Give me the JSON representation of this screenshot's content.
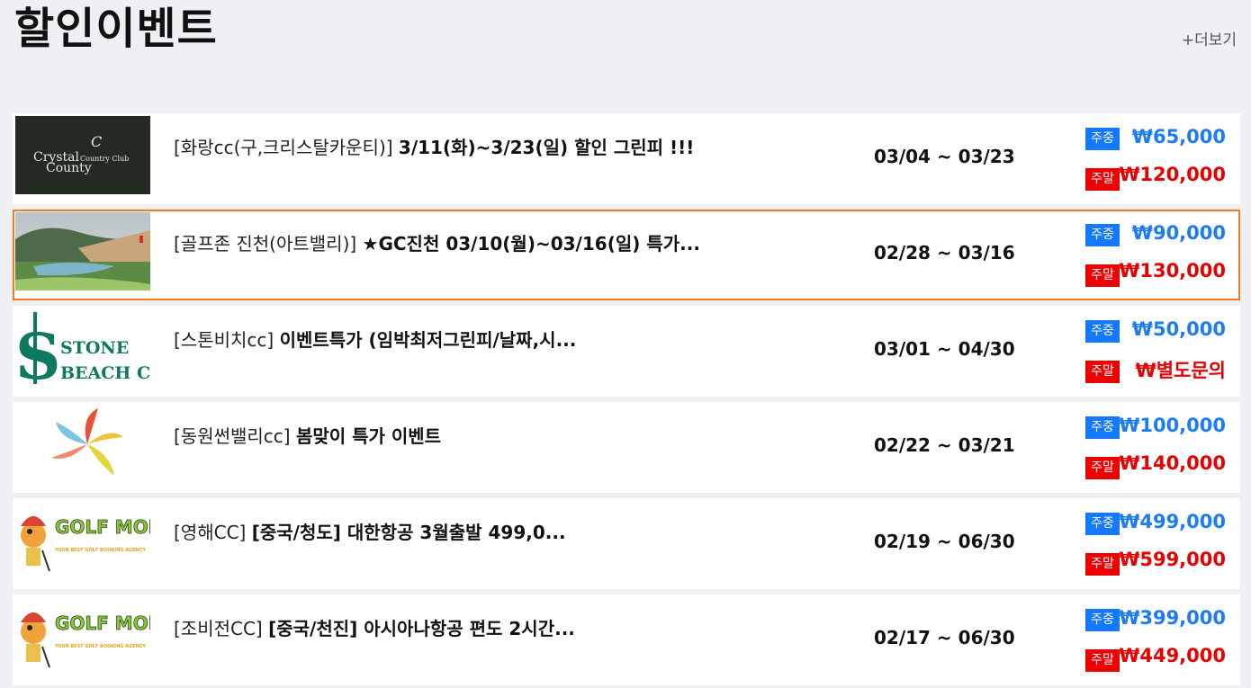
{
  "header": {
    "title": "할인이벤트",
    "more_label": "+더보기"
  },
  "badges": {
    "weekday": "주중",
    "weekend": "주말"
  },
  "events": [
    {
      "logo": "crystal-county-logo",
      "logo_text": [
        "Crystal",
        "County",
        "Country Club"
      ],
      "club": "[화랑cc(구,크리스탈카운티)]",
      "title": "3/11(화)~3/23(일) 할인 그린피 !!!",
      "period": "03/04 ~ 03/23",
      "weekday_price": "₩65,000",
      "weekend_price": "₩120,000"
    },
    {
      "logo": "golf-course-photo",
      "club": "[골프존 진천(아트밸리)]",
      "title": "★GC진천 03/10(월)~03/16(일) 특가...",
      "period": "02/28 ~ 03/16",
      "weekday_price": "₩90,000",
      "weekend_price": "₩130,000"
    },
    {
      "logo": "stone-beach-logo",
      "logo_text": [
        "STONE",
        "BEACH CC"
      ],
      "club": "[스톤비치cc]",
      "title": "이벤트특가 (임박최저그린피/날짜,시...",
      "period": "03/01 ~ 04/30",
      "weekday_price": "₩50,000",
      "weekend_price": "₩별도문의"
    },
    {
      "logo": "dongwon-sunvalley-logo",
      "club": "[동원썬밸리cc]",
      "title": "봄맞이 특가 이벤트",
      "period": "02/22 ~ 03/21",
      "weekday_price": "₩100,000",
      "weekend_price": "₩140,000"
    },
    {
      "logo": "golfmon-logo",
      "logo_text": [
        "GOLF MON",
        "YOUR BEST GOLF BOOKING AGENCY"
      ],
      "club": "[영해CC]",
      "title": "[중국/청도] 대한항공 3월출발 499,0...",
      "period": "02/19 ~ 06/30",
      "weekday_price": "₩499,000",
      "weekend_price": "₩599,000"
    },
    {
      "logo": "golfmon-logo",
      "logo_text": [
        "GOLF MON",
        "YOUR BEST GOLF BOOKING AGENCY"
      ],
      "club": "[조비전CC]",
      "title": "[중국/천진] 아시아나항공 편도 2시간...",
      "period": "02/17 ~ 06/30",
      "weekday_price": "₩399,000",
      "weekend_price": "₩449,000"
    }
  ],
  "colors": {
    "weekday": "#1479ff",
    "weekend": "#ee0000",
    "highlight": "#f47a20"
  }
}
